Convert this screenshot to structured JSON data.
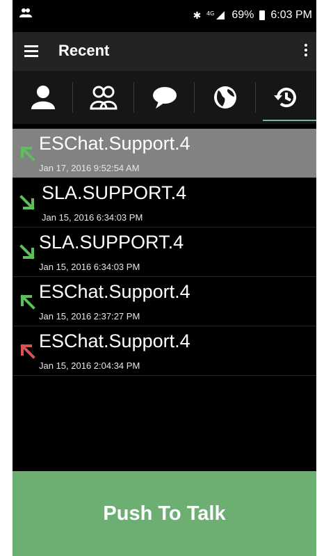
{
  "status_bar": {
    "battery": "69%",
    "time": "6:03 PM",
    "left_icon": "contacts-notification-icon",
    "bluetooth_icon": "bluetooth-icon",
    "signal_icon": "signal-icon"
  },
  "app_bar": {
    "title": "Recent",
    "menu_icon": "hamburger-menu-icon",
    "overflow_icon": "more-vert-icon"
  },
  "tabs": [
    {
      "icon": "contact-icon",
      "active": false
    },
    {
      "icon": "group-icon",
      "active": false
    },
    {
      "icon": "chat-icon",
      "active": false
    },
    {
      "icon": "globe-icon",
      "active": false
    },
    {
      "icon": "history-icon",
      "active": true
    }
  ],
  "calls": [
    {
      "name": "ESChat.Support.4",
      "timestamp": "Jan 17, 2016 9:52:54 AM",
      "direction": "outgoing",
      "arrow_color": "#5cbf5a"
    },
    {
      "name": "SLA.SUPPORT.4",
      "timestamp": "Jan 15, 2016 6:34:03 PM",
      "direction": "incoming",
      "arrow_color": "#5cbf5a"
    },
    {
      "name": "SLA.SUPPORT.4",
      "timestamp": "Jan 15, 2016 6:34:03 PM",
      "direction": "incoming",
      "arrow_color": "#5cbf5a"
    },
    {
      "name": "ESChat.Support.4",
      "timestamp": "Jan 15, 2016 2:37:27 PM",
      "direction": "outgoing",
      "arrow_color": "#5cbf5a"
    },
    {
      "name": "ESChat.Support.4",
      "timestamp": "Jan 15, 2016 2:04:34 PM",
      "direction": "missed-outgoing",
      "arrow_color": "#d9534f"
    }
  ],
  "ptt": {
    "label": "Push To Talk",
    "color": "#6daf73"
  }
}
